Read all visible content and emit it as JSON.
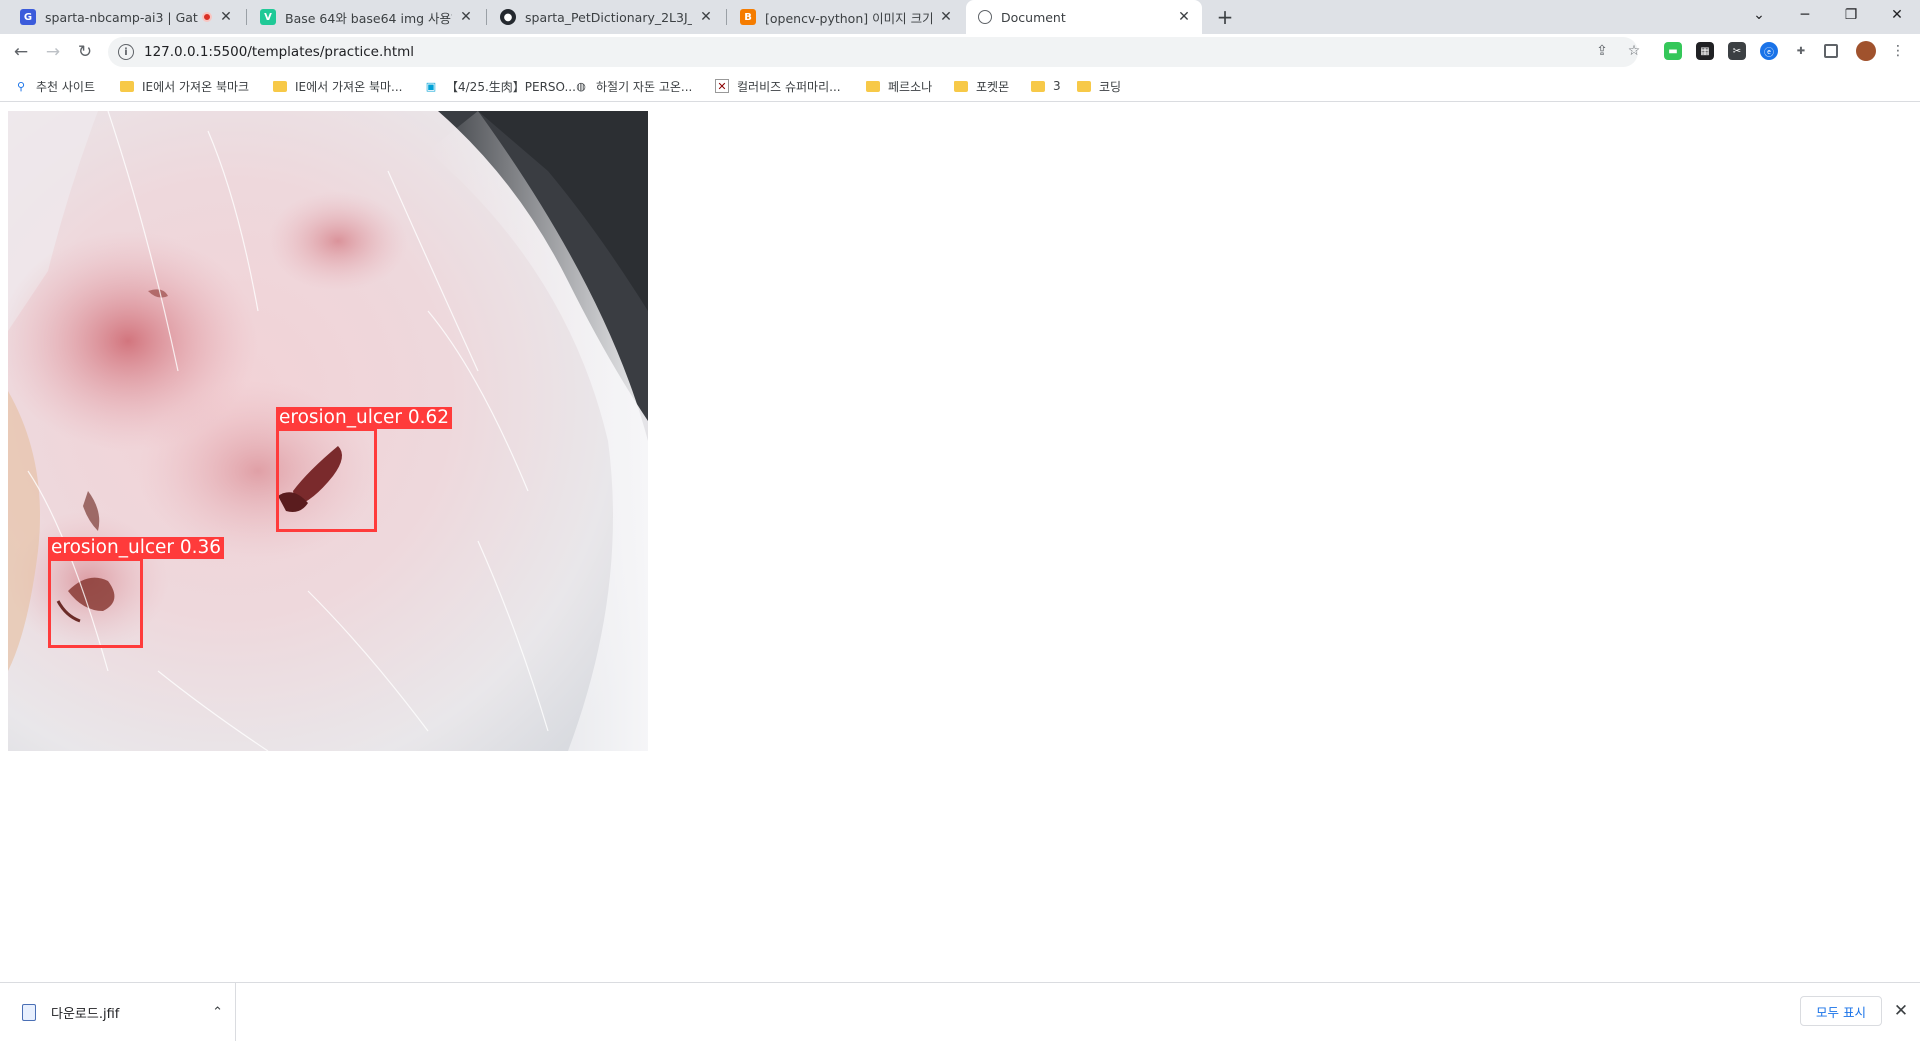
{
  "browser": {
    "tabs": [
      {
        "title": "sparta-nbcamp-ai3 | Gather",
        "favicon": "gather-icon",
        "recording": true
      },
      {
        "title": "Base 64와 base64 img 사용하기",
        "favicon": "velog-icon"
      },
      {
        "title": "sparta_PetDictionary_2L3J_proje",
        "favicon": "github-icon"
      },
      {
        "title": "[opencv-python] 이미지 크기조",
        "favicon": "blogger-icon"
      },
      {
        "title": "Document",
        "favicon": "globe-icon",
        "active": true
      }
    ],
    "url": "127.0.0.1:5500/templates/practice.html"
  },
  "bookmarks": [
    {
      "label": "추천 사이트",
      "icon": "search-icon"
    },
    {
      "label": "IE에서 가져온 북마크",
      "icon": "folder-icon"
    },
    {
      "label": "IE에서 가져온 북마...",
      "icon": "folder-icon"
    },
    {
      "label": "【4/25.生肉】PERSO...",
      "icon": "bilibili-icon"
    },
    {
      "label": "하절기 자돈 고온...",
      "icon": "globe-icon"
    },
    {
      "label": "컬러비즈 슈퍼마리...",
      "icon": "broken-image-icon"
    },
    {
      "label": "페르소나",
      "icon": "folder-icon"
    },
    {
      "label": "포켓몬",
      "icon": "folder-icon"
    },
    {
      "label": "3",
      "icon": "folder-icon"
    },
    {
      "label": "코딩",
      "icon": "folder-icon"
    }
  ],
  "detections": [
    {
      "label": "erosion_ulcer 0.62",
      "class": "erosion_ulcer",
      "confidence": 0.62
    },
    {
      "label": "erosion_ulcer 0.36",
      "class": "erosion_ulcer",
      "confidence": 0.36
    }
  ],
  "downloads": {
    "file_name": "다운로드.jfif",
    "show_all": "모두 표시"
  },
  "colors": {
    "detection": "#ff3b3b",
    "tabstrip": "#dee1e6",
    "link": "#1a73e8"
  }
}
